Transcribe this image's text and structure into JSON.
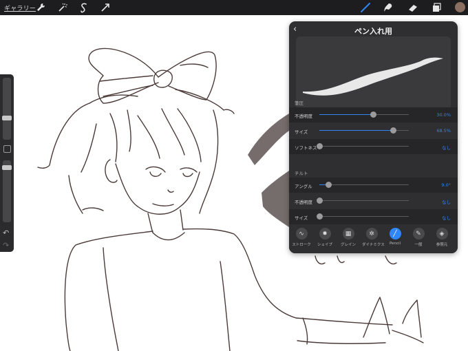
{
  "topbar": {
    "gallery_label": "ギャラリー",
    "left_tools": [
      "wrench-icon",
      "magic-wand-icon",
      "selection-icon",
      "transform-arrow-icon"
    ],
    "right_tools": [
      "brush-icon",
      "smudge-icon",
      "eraser-icon",
      "layers-icon"
    ],
    "active_tool": "brush-icon",
    "color_swatch": "#8b6f62"
  },
  "sidebar": {
    "size_level": 0.28,
    "opacity_level": 0.08
  },
  "panel": {
    "back_label": "‹",
    "title": "ペン入れ用",
    "sections": {
      "pressure": "筆圧",
      "tilt": "チルト"
    },
    "pressure_rows": [
      {
        "label": "不透明度",
        "value": "30.0%",
        "level": 0.6
      },
      {
        "label": "サイズ",
        "value": "68.5%",
        "level": 0.82
      },
      {
        "label": "ソフトネス",
        "value": "なし",
        "level": 0.0
      }
    ],
    "tilt_rows": [
      {
        "label": "アングル",
        "value": "9.0°",
        "level": 0.1
      },
      {
        "label": "不透明度",
        "value": "なし",
        "level": 0.0
      },
      {
        "label": "サイズ",
        "value": "なし",
        "level": 0.0
      }
    ],
    "tabs": [
      {
        "label": "ストローク",
        "icon": "stroke-icon"
      },
      {
        "label": "シェイプ",
        "icon": "shape-icon"
      },
      {
        "label": "グレイン",
        "icon": "grain-icon"
      },
      {
        "label": "ダイナミクス",
        "icon": "dynamics-icon"
      },
      {
        "label": "Pencil",
        "icon": "pencil-icon",
        "active": true
      },
      {
        "label": "一般",
        "icon": "general-icon"
      },
      {
        "label": "参照元",
        "icon": "source-icon"
      }
    ]
  },
  "colors": {
    "accent": "#2f86f6",
    "panel_bg": "#2f2f31",
    "topbar_bg": "#1d1d1f"
  }
}
